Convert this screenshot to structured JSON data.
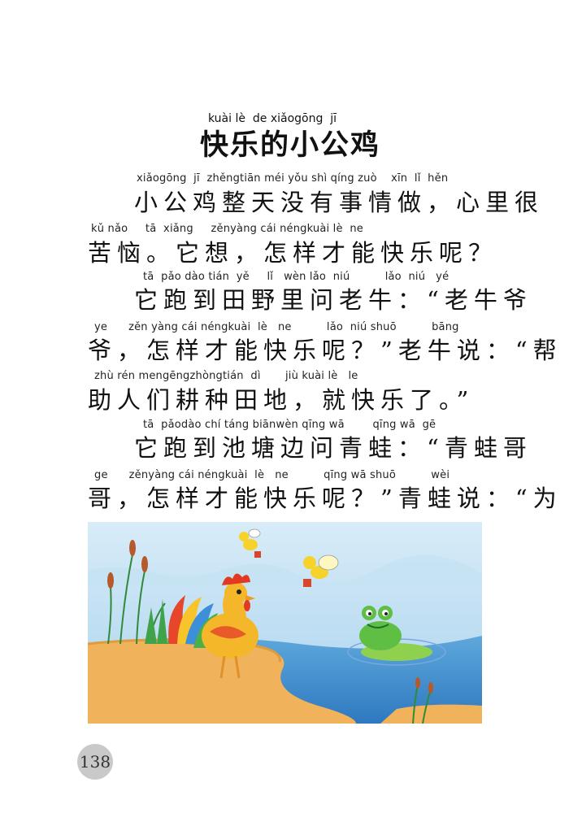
{
  "title": {
    "pinyin": "kuài lè  de xiǎogōng  jī",
    "text": "快乐的小公鸡"
  },
  "lines": [
    {
      "pinyin": "xiǎogōng  jī  zhěngtiān méi yǒu shì qíng zuò    xīn  lǐ  hěn",
      "text": "小公鸡整天没有事情做，心里很"
    },
    {
      "pinyin": "kǔ nǎo     tā  xiǎng     zěnyàng cái néngkuài lè  ne",
      "text": "苦恼。它想，怎样才能快乐呢？"
    },
    {
      "pinyin": "tā  pǎo dào tián  yě     lǐ   wèn lǎo  niú          lǎo  niú   yé",
      "text": "它跑到田野里问老牛：“老牛爷"
    },
    {
      "pinyin": "ye      zěn yàng cái néngkuài  lè   ne          lǎo  niú shuō          bāng",
      "text": "爷，怎样才能快乐呢？”老牛说：“帮"
    },
    {
      "pinyin": "zhù rén mengēngzhòngtián  dì       jiù kuài lè   le",
      "text": "助人们耕种田地，就快乐了。”"
    },
    {
      "pinyin": "tā  pǎodào chí táng biānwèn qīng wā        qīng wā  gē",
      "text": "它跑到池塘边问青蛙：“青蛙哥"
    },
    {
      "pinyin": "ge      zěnyàng cái néngkuài  lè   ne          qīng wā shuō          wèi",
      "text": "哥，怎样才能快乐呢？”青蛙说：“为"
    }
  ],
  "page_number": "138"
}
